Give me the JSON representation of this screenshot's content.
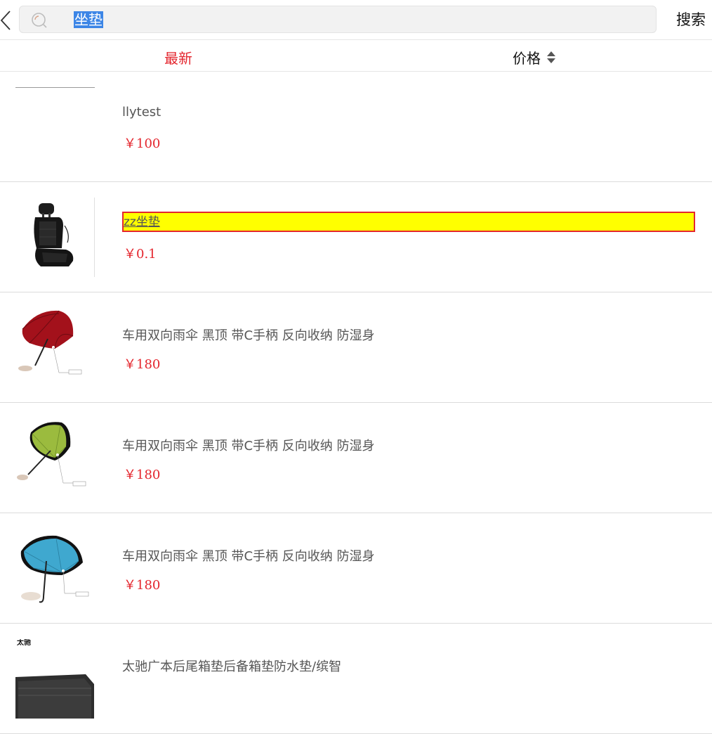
{
  "header": {
    "back_icon": "chevron-left-icon",
    "search_icon": "search-icon",
    "search_query": "坐垫",
    "search_button": "搜索"
  },
  "sort_bar": {
    "latest_label": "最新",
    "price_label": "价格",
    "active_color": "#e4262e"
  },
  "products": [
    {
      "title": "llytest",
      "price": "￥100",
      "image": "blank"
    },
    {
      "title": "zz坐垫",
      "price": "￥0.1",
      "image": "car-seat-cushion",
      "highlighted": true
    },
    {
      "title": "车用双向雨伞 黑顶 带C手柄 反向收纳 防湿身",
      "price": "￥180",
      "image": "red-umbrella"
    },
    {
      "title": "车用双向雨伞 黑顶 带C手柄 反向收纳 防湿身",
      "price": "￥180",
      "image": "green-umbrella"
    },
    {
      "title": "车用双向雨伞 黑顶 带C手柄 反向收纳 防湿身",
      "price": "￥180",
      "image": "blue-umbrella"
    },
    {
      "title": "太驰广本后尾箱垫后备箱垫防水垫/缤智",
      "price": "",
      "image": "trunk-mat",
      "brand_logo": "太驰"
    }
  ]
}
